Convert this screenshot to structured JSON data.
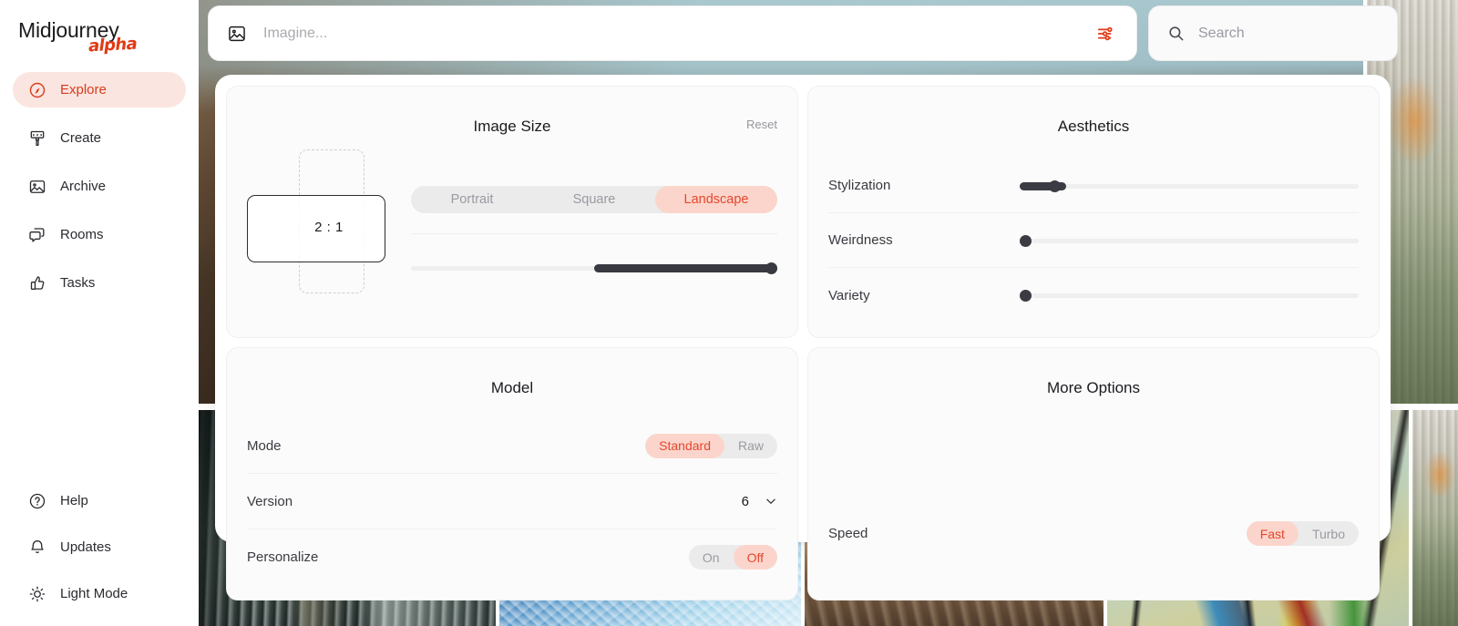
{
  "brand": {
    "name": "Midjourney",
    "tag": "alpha"
  },
  "sidebar": {
    "items": [
      {
        "label": "Explore",
        "icon": "compass-icon",
        "active": true
      },
      {
        "label": "Create",
        "icon": "paintbrush-icon",
        "active": false
      },
      {
        "label": "Archive",
        "icon": "image-icon",
        "active": false
      },
      {
        "label": "Rooms",
        "icon": "chat-icon",
        "active": false
      },
      {
        "label": "Tasks",
        "icon": "thumbs-up-icon",
        "active": false
      }
    ],
    "bottom_items": [
      {
        "label": "Help",
        "icon": "question-circle-icon"
      },
      {
        "label": "Updates",
        "icon": "bell-icon"
      },
      {
        "label": "Light Mode",
        "icon": "sun-icon"
      }
    ]
  },
  "topbar": {
    "imagine": {
      "value": "",
      "placeholder": "Imagine...",
      "icon": "image-icon"
    },
    "settings_button": {
      "icon": "sliders-icon",
      "color": "#e03a14"
    },
    "search": {
      "value": "",
      "placeholder": "Search",
      "icon": "search-icon"
    }
  },
  "panels": {
    "image_size": {
      "title": "Image Size",
      "reset_label": "Reset",
      "ratio_label": "2 : 1",
      "orientation": {
        "options": [
          "Portrait",
          "Square",
          "Landscape"
        ],
        "selected": "Landscape"
      },
      "ratio_slider": {
        "value_pct": 100,
        "fill_start_pct": 50
      }
    },
    "aesthetics": {
      "title": "Aesthetics",
      "sliders": [
        {
          "label": "Stylization",
          "value_pct": 12
        },
        {
          "label": "Weirdness",
          "value_pct": 0
        },
        {
          "label": "Variety",
          "value_pct": 0
        }
      ]
    },
    "model": {
      "title": "Model",
      "rows": {
        "mode": {
          "label": "Mode",
          "options": [
            "Standard",
            "Raw"
          ],
          "selected": "Standard"
        },
        "version": {
          "label": "Version",
          "value": "6",
          "icon": "chevron-down-icon"
        },
        "personalize": {
          "label": "Personalize",
          "options": [
            "On",
            "Off"
          ],
          "selected": "Off"
        }
      }
    },
    "more_options": {
      "title": "More Options",
      "rows": {
        "speed": {
          "label": "Speed",
          "options": [
            "Fast",
            "Turbo"
          ],
          "selected": "Fast"
        }
      }
    }
  },
  "gallery": {
    "top_row": [
      {
        "name": "cliff-landscape"
      },
      {
        "name": "city-aerial"
      }
    ],
    "bottom_row": [
      {
        "name": "waterfall-canyon"
      },
      {
        "name": "blue-ice-crystal"
      },
      {
        "name": "driftwood-fern"
      },
      {
        "name": "stained-glass"
      }
    ]
  },
  "colors": {
    "accent": "#e03a14",
    "accent_soft_bg": "#fbd5cb",
    "accent_text": "#e5472d",
    "nav_active_bg": "#fbe5e0",
    "nav_active_text": "#d73c1c",
    "slider_dark": "#3b3b44",
    "track_light": "#efefef"
  }
}
